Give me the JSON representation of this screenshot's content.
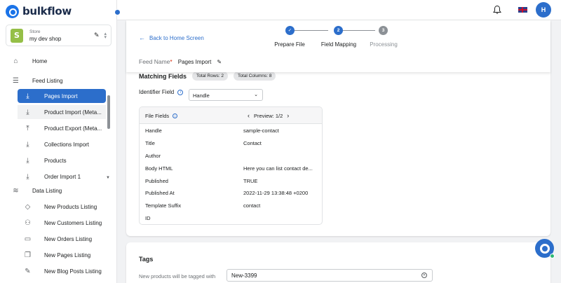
{
  "app": {
    "logo_text": "bulkflow"
  },
  "store": {
    "label": "Store",
    "name": "my dev shop"
  },
  "sidebar": {
    "home": "Home",
    "feed_listing": "Feed Listing",
    "feed_items": [
      {
        "label": "Pages Import"
      },
      {
        "label": "Product Import (Meta..."
      },
      {
        "label": "Product Export (Meta..."
      },
      {
        "label": "Collections Import"
      },
      {
        "label": "Products"
      },
      {
        "label": "Order Import 1"
      }
    ],
    "data_listing": "Data Listing",
    "data_items": [
      {
        "label": "New Products Listing"
      },
      {
        "label": "New Customers Listing"
      },
      {
        "label": "New Orders Listing"
      },
      {
        "label": "New Pages Listing"
      },
      {
        "label": "New Blog Posts Listing"
      }
    ]
  },
  "topbar": {
    "avatar_initial": "H"
  },
  "header": {
    "back_label": "Back to Home Screen",
    "steps": [
      {
        "number": "",
        "label": "Prepare File",
        "state": "done"
      },
      {
        "number": "2",
        "label": "Field Mapping",
        "state": "active"
      },
      {
        "number": "3",
        "label": "Processing",
        "state": "pending"
      }
    ],
    "feed_name_label": "Feed Name",
    "feed_name_required": "*",
    "feed_name_value": "Pages Import"
  },
  "matching": {
    "title": "Matching Fields",
    "total_rows": "Total Rows: 2",
    "total_columns": "Total Columns: 8"
  },
  "identifier": {
    "label": "Identifier Field",
    "value": "Handle"
  },
  "table": {
    "col_file_fields": "File Fields",
    "preview": "Preview: 1/2",
    "rows": [
      {
        "field": "Handle",
        "value": "sample-contact"
      },
      {
        "field": "Title",
        "value": "Contact"
      },
      {
        "field": "Author",
        "value": ""
      },
      {
        "field": "Body HTML",
        "value": "Here you can list contact de..."
      },
      {
        "field": "Published",
        "value": "TRUE"
      },
      {
        "field": "Published At",
        "value": "2022-11-29 13:38:48 +0200"
      },
      {
        "field": "Template Suffix",
        "value": "contact"
      },
      {
        "field": "ID",
        "value": ""
      }
    ]
  },
  "tags": {
    "title": "Tags",
    "label": "New products will be tagged with",
    "value": "New-3399"
  },
  "colors": {
    "accent": "#2c6ecb",
    "success": "#2eb875",
    "shopify": "#95bf47"
  }
}
